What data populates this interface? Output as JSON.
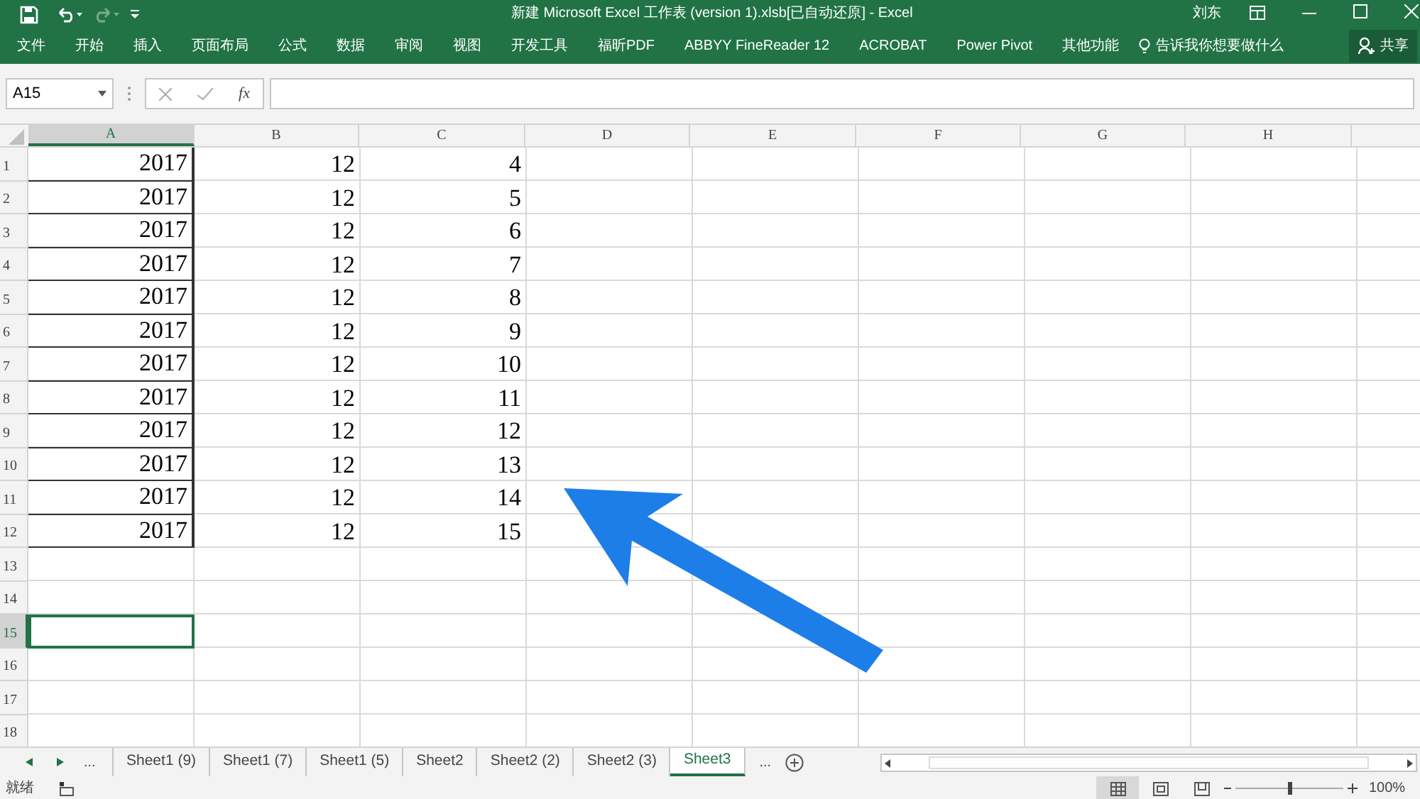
{
  "title_bar": {
    "title": "新建 Microsoft Excel 工作表 (version 1).xlsb[已自动还原]  -  Excel",
    "user": "刘东"
  },
  "ribbon_tabs": [
    {
      "label": "文件"
    },
    {
      "label": "开始"
    },
    {
      "label": "插入"
    },
    {
      "label": "页面布局"
    },
    {
      "label": "公式"
    },
    {
      "label": "数据"
    },
    {
      "label": "审阅"
    },
    {
      "label": "视图"
    },
    {
      "label": "开发工具"
    },
    {
      "label": "福昕PDF"
    },
    {
      "label": "ABBYY FineReader 12"
    },
    {
      "label": "ACROBAT"
    },
    {
      "label": "Power Pivot"
    },
    {
      "label": "其他功能"
    }
  ],
  "tell_me": "告诉我你想要做什么",
  "share": "共享",
  "name_box": "A15",
  "fx": "fx",
  "columns": [
    {
      "label": "A",
      "selected": true
    },
    {
      "label": "B",
      "selected": false
    },
    {
      "label": "C",
      "selected": false
    },
    {
      "label": "D",
      "selected": false
    },
    {
      "label": "E",
      "selected": false
    },
    {
      "label": "F",
      "selected": false
    },
    {
      "label": "G",
      "selected": false
    },
    {
      "label": "H",
      "selected": false
    }
  ],
  "rows": [
    {
      "number": "1",
      "selected": false,
      "cells": [
        "2017",
        "12",
        "4"
      ]
    },
    {
      "number": "2",
      "selected": false,
      "cells": [
        "2017",
        "12",
        "5"
      ]
    },
    {
      "number": "3",
      "selected": false,
      "cells": [
        "2017",
        "12",
        "6"
      ]
    },
    {
      "number": "4",
      "selected": false,
      "cells": [
        "2017",
        "12",
        "7"
      ]
    },
    {
      "number": "5",
      "selected": false,
      "cells": [
        "2017",
        "12",
        "8"
      ]
    },
    {
      "number": "6",
      "selected": false,
      "cells": [
        "2017",
        "12",
        "9"
      ]
    },
    {
      "number": "7",
      "selected": false,
      "cells": [
        "2017",
        "12",
        "10"
      ]
    },
    {
      "number": "8",
      "selected": false,
      "cells": [
        "2017",
        "12",
        "11"
      ]
    },
    {
      "number": "9",
      "selected": false,
      "cells": [
        "2017",
        "12",
        "12"
      ]
    },
    {
      "number": "10",
      "selected": false,
      "cells": [
        "2017",
        "12",
        "13"
      ]
    },
    {
      "number": "11",
      "selected": false,
      "cells": [
        "2017",
        "12",
        "14"
      ]
    },
    {
      "number": "12",
      "selected": false,
      "cells": [
        "2017",
        "12",
        "15"
      ]
    },
    {
      "number": "13",
      "selected": false,
      "cells": []
    },
    {
      "number": "14",
      "selected": false,
      "cells": []
    },
    {
      "number": "15",
      "selected": true,
      "cells": []
    },
    {
      "number": "16",
      "selected": false,
      "cells": []
    },
    {
      "number": "17",
      "selected": false,
      "cells": []
    },
    {
      "number": "18",
      "selected": false,
      "cells": []
    }
  ],
  "sheet_tabs": [
    {
      "label": "Sheet1 (9)",
      "selected": false
    },
    {
      "label": "Sheet1 (7)",
      "selected": false
    },
    {
      "label": "Sheet1 (5)",
      "selected": false
    },
    {
      "label": "Sheet2",
      "selected": false
    },
    {
      "label": "Sheet2 (2)",
      "selected": false
    },
    {
      "label": "Sheet2 (3)",
      "selected": false
    },
    {
      "label": "Sheet3",
      "selected": true
    }
  ],
  "tab_more_left": "...",
  "tab_more_right": "...",
  "status": "就绪",
  "zoom": "100%",
  "zoom_slider": {
    "level": 0.5
  }
}
